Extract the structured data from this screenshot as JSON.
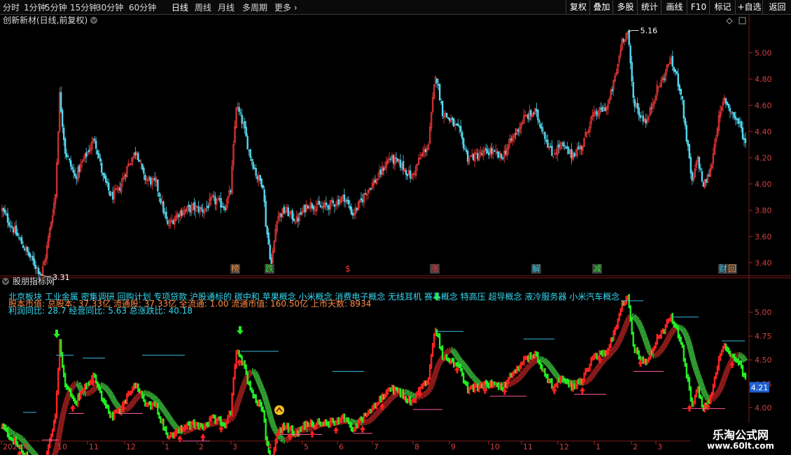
{
  "toolbar": {
    "periods": [
      {
        "label": "分时",
        "active": false
      },
      {
        "label": "1分钟",
        "active": false
      },
      {
        "label": "5分钟",
        "active": false
      },
      {
        "label": "15分钟",
        "active": false
      },
      {
        "label": "30分钟",
        "active": false
      },
      {
        "label": "60分钟",
        "active": false
      },
      {
        "label": "日线",
        "active": true
      },
      {
        "label": "周线",
        "active": false
      },
      {
        "label": "月线",
        "active": false
      },
      {
        "label": "多周期",
        "active": false
      },
      {
        "label": "更多",
        "active": false
      }
    ],
    "more_arrow": "›",
    "buttons": [
      "复权",
      "叠加",
      "多股",
      "统计",
      "画线",
      "F10",
      "标记",
      "+自选",
      "返回"
    ]
  },
  "main_panel": {
    "title": "创新新材(日线,前复权)",
    "collapse_icon": "chevron-down",
    "high_label": "5.16",
    "low_label": "3.31",
    "y_ticks": [
      "5.00",
      "4.80",
      "4.60",
      "4.40",
      "4.20",
      "4.00",
      "3.80",
      "3.60",
      "3.40"
    ],
    "y_range": [
      3.3,
      5.2
    ],
    "event_markers": [
      {
        "text": "榜",
        "color": "#ff8a3a",
        "boxed": true
      },
      {
        "text": "跌",
        "color": "#33e033",
        "boxed": true
      },
      {
        "text": "$",
        "color": "#ff3030",
        "boxed": false
      },
      {
        "text": "涨",
        "color": "#ff3030",
        "boxed": true
      },
      {
        "text": "解",
        "color": "#36c8e8",
        "boxed": true
      },
      {
        "text": "减",
        "color": "#33e033",
        "boxed": true
      },
      {
        "text": "财",
        "color": "#36c8e8",
        "boxed": true
      },
      {
        "text": "回",
        "color": "#ff8a3a",
        "boxed": true
      }
    ]
  },
  "indicator_panel": {
    "title": "股朋指标网",
    "concepts": "北京板块 工业金属 密集调研 回购计划 专项贷款 沪股通标的 碳中和 苹果概念 小米概念 消费电子概念 无线耳机 赛马概念 特高压 超导概念 液冷服务器 小米汽车概念",
    "market_info": "股本市值: 总股本: 37.33亿 流通股: 37.33亿 全流通: 1.00 流通市值: 160.50亿 上市天数: 8934",
    "profit_info": "利润同比: 28.7 经营同比: 5.63 总涨跌比: 40.18",
    "y_ticks": [
      "5.00",
      "4.75",
      "4.50",
      "4.25",
      "4.00",
      "3.75"
    ],
    "y_range": [
      3.65,
      5.25
    ],
    "current_price": "4.21"
  },
  "x_axis": {
    "labels": [
      "2024年",
      "10",
      "11",
      "12",
      "1",
      "2",
      "3",
      "4",
      "5",
      "6",
      "7",
      "8",
      "9",
      "10",
      "11",
      "12",
      "1",
      "2",
      "3"
    ]
  },
  "chart_data": {
    "type": "candlestick",
    "title": "创新新材(日线,前复权)",
    "price_range": [
      3.3,
      5.2
    ],
    "keypoints": [
      [
        0,
        3.8
      ],
      [
        10,
        3.62
      ],
      [
        20,
        3.44
      ],
      [
        25,
        3.36
      ],
      [
        28,
        3.31
      ],
      [
        31,
        3.45
      ],
      [
        38,
        3.92
      ],
      [
        41,
        4.68
      ],
      [
        45,
        4.25
      ],
      [
        52,
        4.05
      ],
      [
        58,
        4.18
      ],
      [
        66,
        4.35
      ],
      [
        72,
        4.05
      ],
      [
        78,
        3.9
      ],
      [
        83,
        3.95
      ],
      [
        90,
        4.15
      ],
      [
        96,
        4.26
      ],
      [
        101,
        4.05
      ],
      [
        110,
        4.0
      ],
      [
        118,
        3.68
      ],
      [
        126,
        3.78
      ],
      [
        136,
        3.82
      ],
      [
        144,
        3.8
      ],
      [
        150,
        3.88
      ],
      [
        159,
        3.83
      ],
      [
        163,
        3.95
      ],
      [
        167,
        4.6
      ],
      [
        172,
        4.45
      ],
      [
        176,
        4.25
      ],
      [
        182,
        4.05
      ],
      [
        186,
        4.0
      ],
      [
        188,
        3.7
      ],
      [
        192,
        3.38
      ],
      [
        196,
        3.75
      ],
      [
        202,
        3.8
      ],
      [
        210,
        3.72
      ],
      [
        218,
        3.85
      ],
      [
        228,
        3.82
      ],
      [
        236,
        3.85
      ],
      [
        244,
        3.9
      ],
      [
        250,
        3.77
      ],
      [
        255,
        3.85
      ],
      [
        260,
        3.95
      ],
      [
        268,
        4.05
      ],
      [
        276,
        4.2
      ],
      [
        284,
        4.15
      ],
      [
        292,
        4.05
      ],
      [
        298,
        4.2
      ],
      [
        304,
        4.3
      ],
      [
        309,
        4.85
      ],
      [
        314,
        4.55
      ],
      [
        320,
        4.48
      ],
      [
        326,
        4.4
      ],
      [
        332,
        4.2
      ],
      [
        340,
        4.22
      ],
      [
        348,
        4.25
      ],
      [
        356,
        4.2
      ],
      [
        364,
        4.35
      ],
      [
        372,
        4.5
      ],
      [
        380,
        4.55
      ],
      [
        386,
        4.4
      ],
      [
        392,
        4.22
      ],
      [
        398,
        4.3
      ],
      [
        406,
        4.22
      ],
      [
        414,
        4.3
      ],
      [
        420,
        4.5
      ],
      [
        426,
        4.55
      ],
      [
        432,
        4.6
      ],
      [
        438,
        4.85
      ],
      [
        442,
        5.1
      ],
      [
        446,
        5.16
      ],
      [
        450,
        4.65
      ],
      [
        455,
        4.52
      ],
      [
        460,
        4.48
      ],
      [
        466,
        4.7
      ],
      [
        472,
        4.82
      ],
      [
        476,
        4.95
      ],
      [
        480,
        4.85
      ],
      [
        484,
        4.7
      ],
      [
        488,
        4.35
      ],
      [
        492,
        4.0
      ],
      [
        496,
        4.2
      ],
      [
        500,
        3.98
      ],
      [
        505,
        4.1
      ],
      [
        510,
        4.45
      ],
      [
        515,
        4.65
      ],
      [
        520,
        4.55
      ],
      [
        526,
        4.45
      ],
      [
        530,
        4.3
      ]
    ],
    "bar_count": 531,
    "dates_axis": [
      "2024年",
      "10",
      "11",
      "12",
      "1",
      "2",
      "3",
      "4",
      "5",
      "6",
      "7",
      "8",
      "9",
      "10",
      "11",
      "12",
      "1",
      "2",
      "3"
    ],
    "series_note_high": "5.16",
    "series_note_low": "3.31",
    "current": 4.21,
    "colors": {
      "up": "#ff3b3b",
      "down": "#54d8f0",
      "ind_up": "#ff2222",
      "ind_down": "#22ee22",
      "ribbon_dark": "#8a1a1a",
      "ribbon_green": "#2f9a2f",
      "ref_line": "#3ab8d8"
    }
  }
}
